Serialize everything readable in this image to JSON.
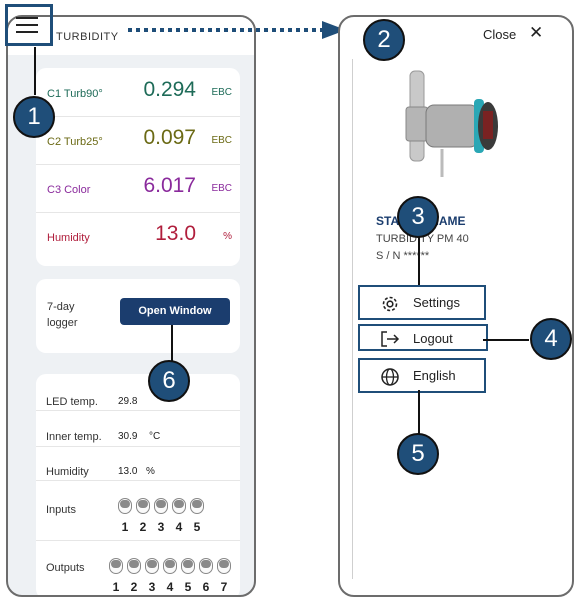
{
  "app": {
    "title": "TURBIDITY"
  },
  "measurements": [
    {
      "label": "C1 Turb90°",
      "value": "0.294",
      "unit": "EBC",
      "color": "#1e6b58"
    },
    {
      "label": "C2 Turb25°",
      "value": "0.097",
      "unit": "EBC",
      "color": "#6b6a15"
    },
    {
      "label": "C3 Color",
      "value": "6.017",
      "unit": "EBC",
      "color": "#8a2a9c"
    },
    {
      "label": "Humidity",
      "value": "13.0",
      "unit": "%",
      "color": "#b01e3c"
    }
  ],
  "logger": {
    "label": "7-day logger",
    "button": "Open Window"
  },
  "status": {
    "led_temp": {
      "label": "LED temp.",
      "value": "29.8"
    },
    "inner_temp": {
      "label": "Inner temp.",
      "value": "30.9",
      "unit": "°C"
    },
    "humidity": {
      "label": "Humidity",
      "value": "13.0",
      "unit": "%"
    },
    "inputs": {
      "label": "Inputs",
      "numbers": [
        "1",
        "2",
        "3",
        "4",
        "5"
      ]
    },
    "outputs": {
      "label": "Outputs",
      "numbers": [
        "1",
        "2",
        "3",
        "4",
        "5",
        "6",
        "7"
      ]
    }
  },
  "panel": {
    "close_label": "Close",
    "close_icon": "close-x-icon",
    "station_name": "STATION NAME",
    "device_type": "TURBIDITY PM 40",
    "serial": "S / N ******",
    "menu": [
      {
        "label": "Settings",
        "icon": "gear-icon"
      },
      {
        "label": "Logout",
        "icon": "logout-icon"
      },
      {
        "label": "English",
        "icon": "globe-icon"
      }
    ]
  },
  "callouts": [
    "1",
    "2",
    "3",
    "4",
    "5",
    "6"
  ],
  "colors": {
    "accent": "#1f4e79",
    "button": "#1b3d6e",
    "background": "#eef1f4"
  }
}
